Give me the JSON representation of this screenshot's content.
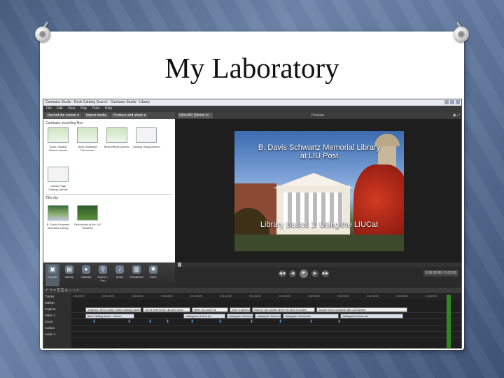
{
  "slide": {
    "title": "My Laboratory"
  },
  "app": {
    "window_title": "Camtasia Studio - Book Catalog Search - Camtasia Studio - Library",
    "menu": [
      "File",
      "Edit",
      "View",
      "Play",
      "Tools",
      "Help"
    ],
    "toolbar": [
      "Record the screen ▾",
      "Import media",
      "Produce and share ▾"
    ],
    "clip_bin": {
      "section1_label": "Camtasia recording files",
      "section2_label": "Title clip",
      "thumbs": [
        "Book Catalog Search.camrec",
        "Book Database Full.camrec",
        "Book EBook.camrec",
        "Catalog Using.camrec",
        "Library Page Catalog.camrec",
        "B. Davis Schwartz Memorial Library",
        "Periodicals at the LIU Libraries"
      ]
    },
    "preview": {
      "size_select": "640x480 (Shrink to fit) ▾",
      "label": "Preview",
      "icons": "▣ ⤢",
      "frame_title_line1": "B. Davis Schwartz Memorial Library",
      "frame_title_line2": "at LIU Post",
      "frame_subtitle": "Library Basics  1: Using the LIUCat",
      "timecode": "0:00:00:00 / 0:03:08"
    },
    "player_buttons": [
      "◀◀",
      "◀",
      "▶",
      "▶",
      "▶▶"
    ],
    "tasks": [
      {
        "icon": "▣",
        "label": "Clip Bin"
      },
      {
        "icon": "▤",
        "label": "Library"
      },
      {
        "icon": "●",
        "label": "Callouts"
      },
      {
        "icon": "⚲",
        "label": "Zoom-n-Pan"
      },
      {
        "icon": "♪",
        "label": "Audio"
      },
      {
        "icon": "▥",
        "label": "Transitions"
      },
      {
        "icon": "✺",
        "label": "More"
      }
    ],
    "timeline": {
      "tools": "↶ ↷ ✂ ⎘ ⎗ ◎ — ○ +",
      "tracks": [
        "Tracks",
        "Marker",
        "Caption",
        "Video 1",
        "Zoom",
        "Callout",
        "Audio 1"
      ],
      "ticks": [
        "0:00:00;00",
        "0:00:15;00",
        "0:00:30;00",
        "0:00:45;00",
        "0:01:00;00",
        "0:01:15;00",
        "0:01:30;00",
        "0:01:45;00",
        "0:02:00;00",
        "0:02:15;00",
        "0:02:30;00",
        "0:02:45;00",
        "0:03:00;00"
      ],
      "caption_clips": [
        "Academic, ESCI Library Online Catalog ListItem",
        "You've entered the Library's online",
        "When You click Full",
        "Enter a search term",
        "Hold the call number where the Book is located",
        "Sample record complete with Call Number"
      ],
      "video_clips": [
        "Book Catalog Search - Screen",
        "catalog.trec Screen.avi",
        "catalog.trec Screen.avi",
        "catalog.trec Screen.avi",
        "catalog.trec Screen.avi",
        "catalog.trec Screen.avi"
      ]
    }
  }
}
